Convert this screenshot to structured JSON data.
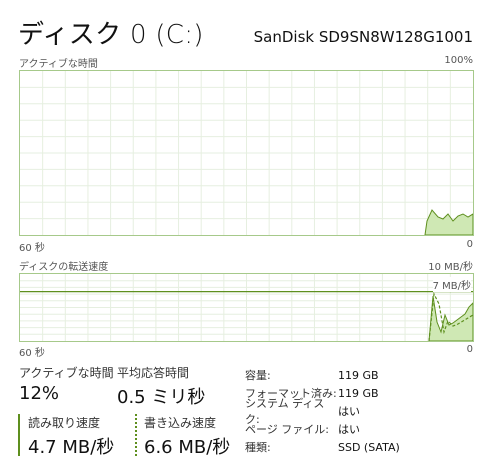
{
  "header": {
    "title": "ディスク 0 (C:)",
    "model": "SanDisk SD9SN8W128G1001"
  },
  "active_time_graph": {
    "label": "アクティブな時間",
    "max_label": "100%",
    "x_left_label": "60 秒",
    "x_right_label": "0"
  },
  "transfer_graph": {
    "label": "ディスクの転送速度",
    "max_label": "10 MB/秒",
    "marker_label": "7 MB/秒",
    "x_left_label": "60 秒",
    "x_right_label": "0"
  },
  "stats": {
    "active_time_label": "アクティブな時間",
    "active_time_value": "12%",
    "response_label": "平均応答時間",
    "response_value": "0.5 ミリ秒",
    "read_label": "読み取り速度",
    "read_value": "4.7 MB/秒",
    "write_label": "書き込み速度",
    "write_value": "6.6 MB/秒"
  },
  "properties": [
    {
      "key": "容量:",
      "value": "119 GB"
    },
    {
      "key": "フォーマット済み:",
      "value": "119 GB"
    },
    {
      "key": "システム ディスク:",
      "value": "はい"
    },
    {
      "key": "ページ ファイル:",
      "value": "はい"
    },
    {
      "key": "種類:",
      "value": "SSD (SATA)"
    }
  ],
  "colors": {
    "accent": "#5e8f1e",
    "fill": "#cfe8b4",
    "grid": "#e6efe0",
    "border": "#a6c98a"
  }
}
